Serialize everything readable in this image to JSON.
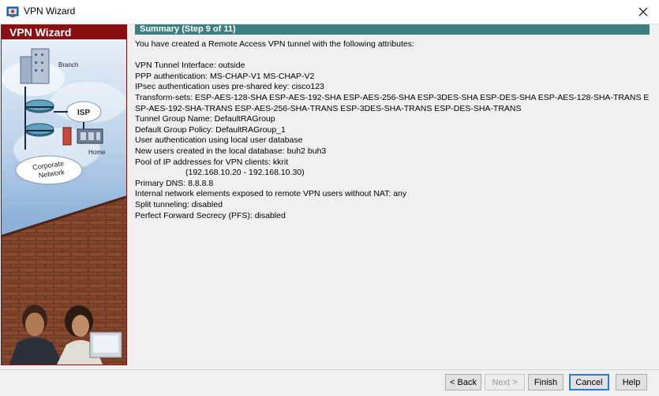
{
  "window": {
    "title": "VPN Wizard",
    "icon": "vpn-wizard-app-icon",
    "close_icon": "close-icon"
  },
  "sidebar": {
    "title": "VPN Wizard",
    "art_labels": {
      "branch": "Branch",
      "isp": "ISP",
      "home": "Home",
      "corporate_network_line1": "Corporate",
      "corporate_network_line2": "Network"
    }
  },
  "summary": {
    "header": "Summary  (Step 9 of 11)",
    "intro": "You have created a Remote Access VPN tunnel with the following attributes:",
    "lines": {
      "tunnel_interface": "VPN Tunnel Interface:  outside",
      "ppp_auth": "PPP authentication: MS-CHAP-V1  MS-CHAP-V2",
      "ipsec_auth": "IPsec authentication uses pre-shared key: cisco123",
      "transform_sets": "Transform-sets: ESP-AES-128-SHA ESP-AES-192-SHA ESP-AES-256-SHA ESP-3DES-SHA ESP-DES-SHA ESP-AES-128-SHA-TRANS ESP-AES-192-SHA-TRANS ESP-AES-256-SHA-TRANS ESP-3DES-SHA-TRANS ESP-DES-SHA-TRANS",
      "tunnel_group": "Tunnel Group Name:  DefaultRAGroup",
      "group_policy": "Default Group Policy:  DefaultRAGroup_1",
      "user_auth": "User authentication using local user database",
      "new_users": "New users created in the local database:  buh2  buh3",
      "pool": "Pool of IP addresses for VPN clients:  kkrit",
      "pool_range": "(192.168.10.20 - 192.168.10.30)",
      "dns": "Primary DNS:  8.8.8.8",
      "nat_exempt": "Internal network elements exposed to remote VPN users without NAT:  any",
      "split_tunnel": "Split tunneling:  disabled",
      "pfs": "Perfect Forward Secrecy (PFS): disabled"
    }
  },
  "buttons": {
    "back": "< Back",
    "next": "Next >",
    "finish": "Finish",
    "cancel": "Cancel",
    "help": "Help"
  },
  "colors": {
    "sidebar_title_bg": "#8a0f12",
    "header_bg": "#3d7f7f",
    "default_button_border": "#2a7ad7"
  }
}
